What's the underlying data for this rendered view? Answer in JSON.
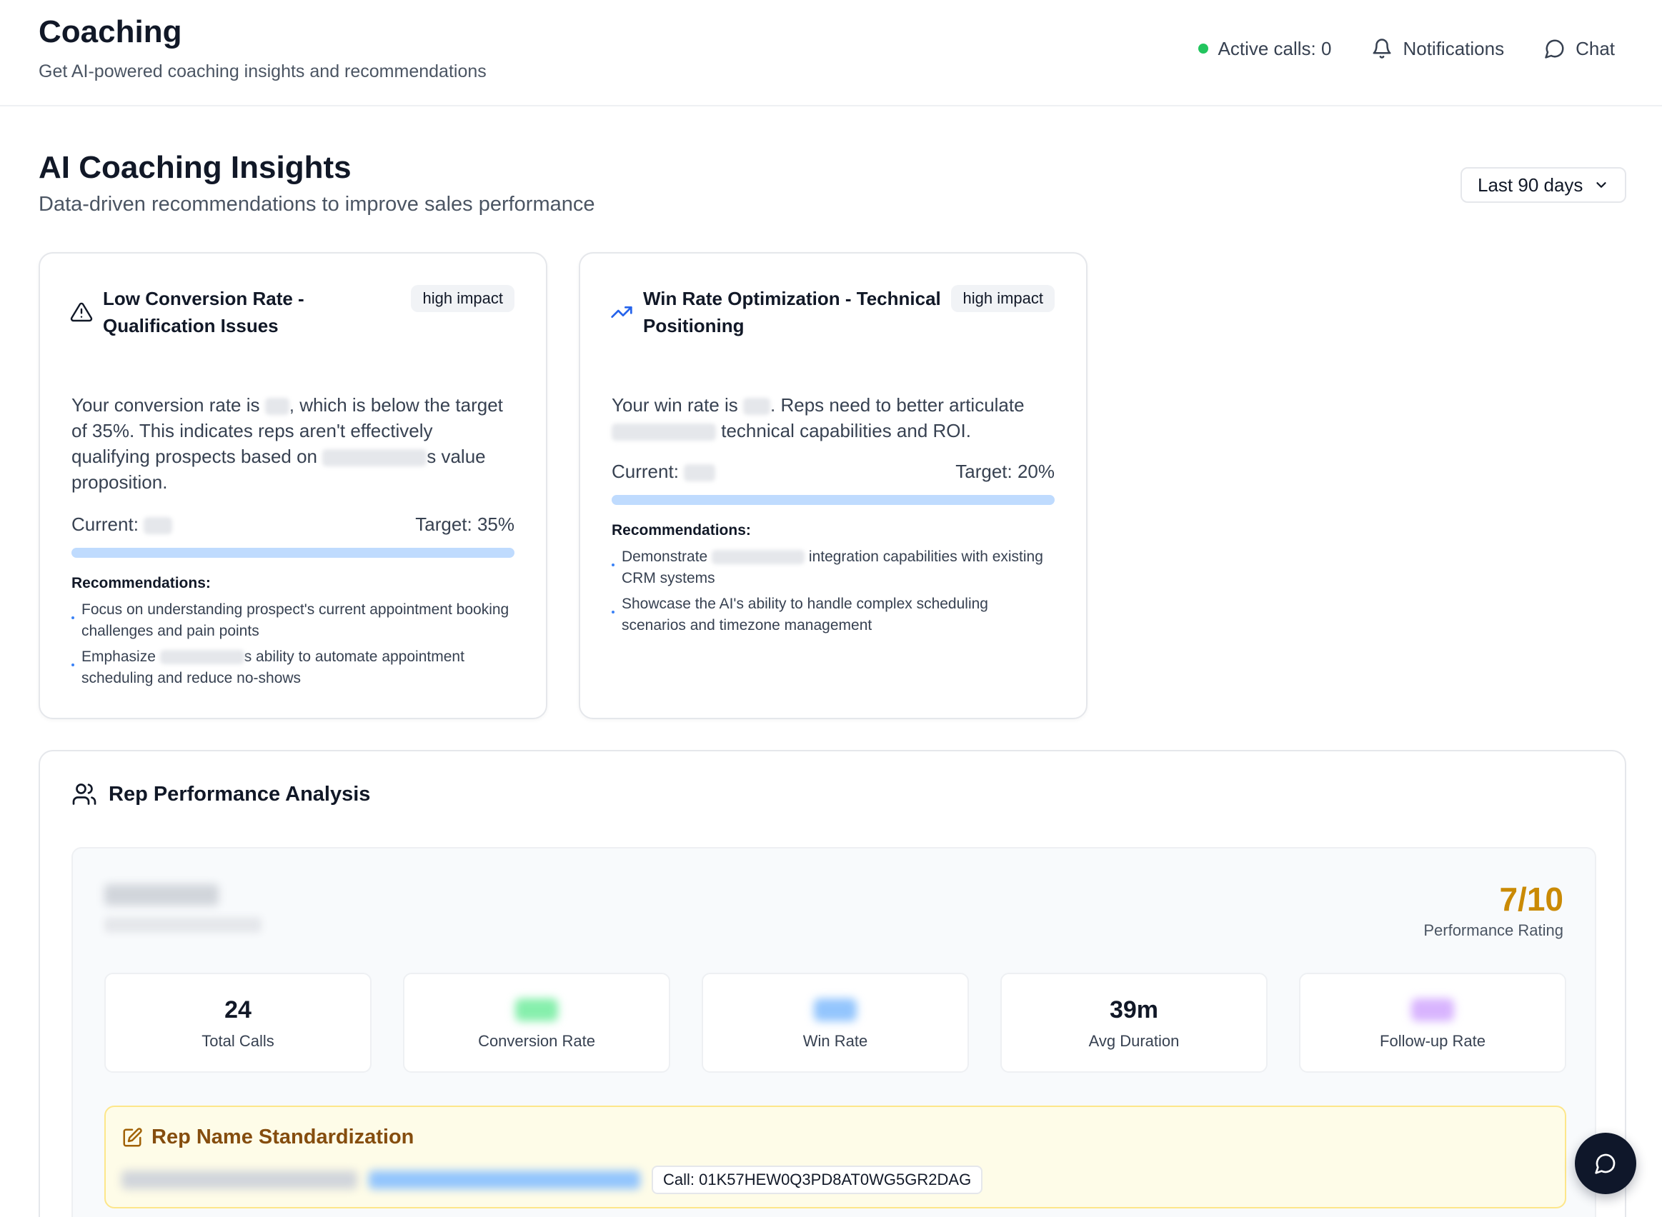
{
  "header": {
    "title": "Coaching",
    "subtitle": "Get AI-powered coaching insights and recommendations",
    "active_calls": "Active calls: 0",
    "notifications": "Notifications",
    "chat": "Chat"
  },
  "insights": {
    "title": "AI Coaching Insights",
    "subtitle": "Data-driven recommendations to improve sales performance",
    "period": "Last 90 days"
  },
  "cards": [
    {
      "title": "Low Conversion Rate - Qualification Issues",
      "badge": "high impact",
      "desc_a": "Your conversion rate is ",
      "desc_b": ", which is below the target of 35%. This indicates reps aren't effectively qualifying prospects based on ",
      "desc_c": "s value proposition.",
      "current_label": "Current: ",
      "target": "Target: 35%",
      "rec_title": "Recommendations:",
      "rec_1": "Focus on understanding prospect's current appointment booking challenges and pain points",
      "rec_2a": "Emphasize ",
      "rec_2b": "s ability to automate appointment scheduling and reduce no-shows"
    },
    {
      "title": "Win Rate Optimization - Technical Positioning",
      "badge": "high impact",
      "desc_a": "Your win rate is ",
      "desc_b": ". Reps need to better articulate ",
      "desc_c": " technical capabilities and ROI.",
      "current_label": "Current: ",
      "target": "Target: 20%",
      "rec_title": "Recommendations:",
      "rec_1a": "Demonstrate ",
      "rec_1b": " integration capabilities with existing CRM systems",
      "rec_2": "Showcase the AI's ability to handle complex scheduling scenarios and timezone management"
    }
  ],
  "rep": {
    "title": "Rep Performance Analysis",
    "rating": "7/10",
    "rating_label": "Performance Rating",
    "stats": [
      {
        "value": "24",
        "label": "Total Calls"
      },
      {
        "value": "",
        "label": "Conversion Rate"
      },
      {
        "value": "",
        "label": "Win Rate"
      },
      {
        "value": "39m",
        "label": "Avg Duration"
      },
      {
        "value": "",
        "label": "Follow-up Rate"
      }
    ],
    "standardization_title": "Rep Name Standardization",
    "call_id": "Call: 01K57HEW0Q3PD8AT0WG5GR2DAG"
  },
  "colors": {
    "accent": "#ca8a04",
    "status_green": "#22c55e",
    "progress": "#bfdbfe",
    "fab": "#0f172a"
  },
  "icons": [
    "bell-icon",
    "chat-icon",
    "chevron-down-icon",
    "warning-icon",
    "trending-up-icon",
    "users-icon",
    "edit-icon"
  ]
}
